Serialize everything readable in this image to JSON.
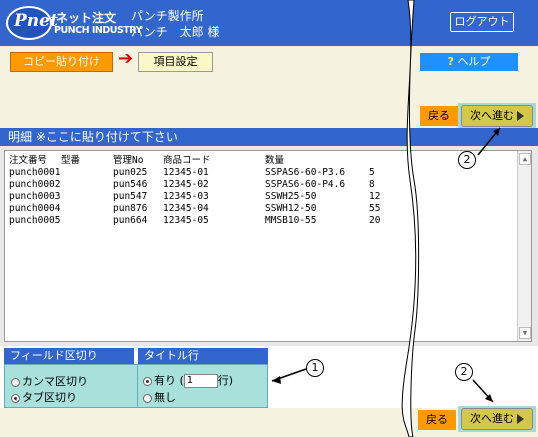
{
  "header": {
    "logo_script": "Pnet",
    "logo_jp": "ネット注文",
    "logo_en": "PUNCH INDUSTRY",
    "company": "パンチ製作所",
    "user": "パンチ　太郎 様",
    "logout_label": "ログアウト"
  },
  "steps": {
    "step1": "コピー貼り付け",
    "arrow": "➔",
    "step2": "項目設定",
    "help_q": "?",
    "help_label": "ヘルプ"
  },
  "nav": {
    "back_label": "戻る",
    "next_label": "次へ進む"
  },
  "detail": {
    "title": "明細 ※ここに貼り付けて下さい",
    "headers": [
      "注文番号",
      "型番",
      "管理No",
      "商品コード",
      "数量"
    ],
    "rows": [
      [
        "punch0001",
        "pun025",
        "12345-01",
        "SSPAS6-60-P3.6",
        "5"
      ],
      [
        "punch0002",
        "pun546",
        "12345-02",
        "SSPAS6-60-P4.6",
        "8"
      ],
      [
        "punch0003",
        "pun547",
        "12345-03",
        "SSWH25-50",
        "12"
      ],
      [
        "punch0004",
        "pun876",
        "12345-04",
        "SSWH12-50",
        "55"
      ],
      [
        "punch0005",
        "pun664",
        "12345-05",
        "MMSB10-55",
        "20"
      ]
    ]
  },
  "options": {
    "field_sep_title": "フィールド区切り",
    "field_sep_comma": "カンマ区切り",
    "field_sep_tab": "タブ区切り",
    "title_row_title": "タイトル行",
    "title_row_yes_prefix": "有り (",
    "title_row_value": "1",
    "title_row_yes_suffix": "行)",
    "title_row_no": "無し"
  },
  "annotations": {
    "one": "1",
    "two": "2"
  },
  "icons": {
    "scroll_up": "scroll-up-icon",
    "scroll_down": "scroll-down-icon",
    "next": "play-icon"
  }
}
